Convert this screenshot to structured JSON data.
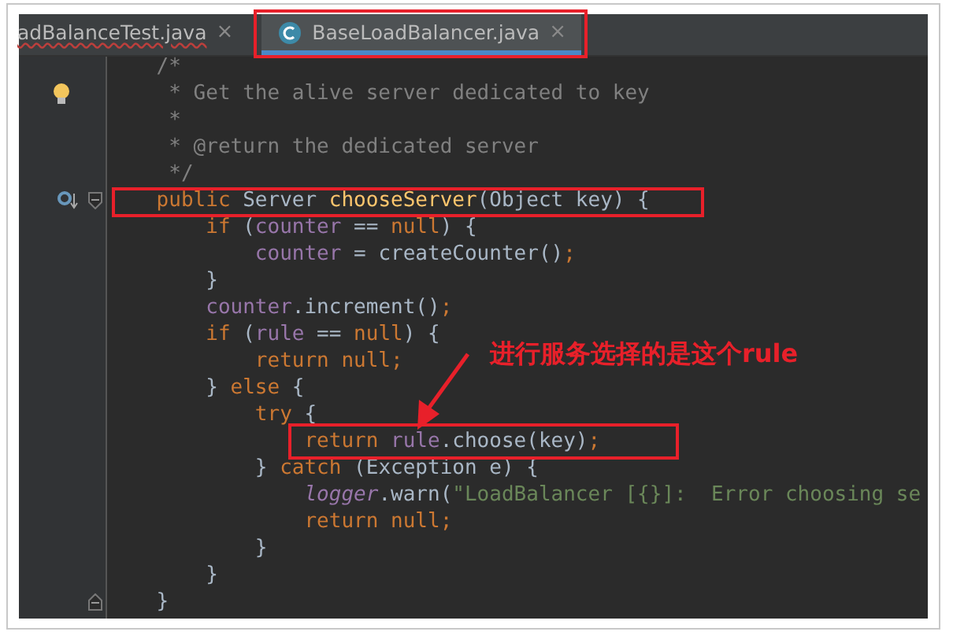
{
  "tabs": [
    {
      "label": "adBalanceTest.java",
      "selected": false,
      "error": true,
      "boxed": false
    },
    {
      "label": "BaseLoadBalancer.java",
      "selected": true,
      "error": false,
      "boxed": true
    }
  ],
  "tab_close": "×",
  "code_lines": [
    {
      "segments": [
        {
          "text": "    /*",
          "kind": "comment"
        }
      ]
    },
    {
      "bulb": true,
      "segments": [
        {
          "text": "     * Get the alive server dedicated to key",
          "kind": "comment"
        }
      ]
    },
    {
      "segments": [
        {
          "text": "     *",
          "kind": "comment"
        }
      ]
    },
    {
      "segments": [
        {
          "text": "     * @return the dedicated server",
          "kind": "comment"
        }
      ]
    },
    {
      "segments": [
        {
          "text": "     */",
          "kind": "comment"
        }
      ]
    },
    {
      "override_marker": true,
      "fold_start": true,
      "boxed": true,
      "segments": [
        {
          "text": "    public ",
          "kind": "keyword"
        },
        {
          "text": "Server ",
          "kind": "plain"
        },
        {
          "text": "chooseServer",
          "kind": "method"
        },
        {
          "text": "(Object key) {",
          "kind": "plain"
        }
      ]
    },
    {
      "segments": [
        {
          "text": "        if ",
          "kind": "keyword"
        },
        {
          "text": "(",
          "kind": "plain"
        },
        {
          "text": "counter",
          "kind": "field"
        },
        {
          "text": " == ",
          "kind": "plain"
        },
        {
          "text": "null",
          "kind": "keyword"
        },
        {
          "text": ") {",
          "kind": "plain"
        }
      ]
    },
    {
      "segments": [
        {
          "text": "            counter",
          "kind": "field"
        },
        {
          "text": " = createCounter()",
          "kind": "plain"
        },
        {
          "text": ";",
          "kind": "keyword"
        }
      ]
    },
    {
      "segments": [
        {
          "text": "        }",
          "kind": "plain"
        }
      ]
    },
    {
      "segments": [
        {
          "text": "        counter",
          "kind": "field"
        },
        {
          "text": ".increment()",
          "kind": "plain"
        },
        {
          "text": ";",
          "kind": "keyword"
        }
      ]
    },
    {
      "segments": [
        {
          "text": "        if ",
          "kind": "keyword"
        },
        {
          "text": "(",
          "kind": "plain"
        },
        {
          "text": "rule",
          "kind": "field"
        },
        {
          "text": " == ",
          "kind": "plain"
        },
        {
          "text": "null",
          "kind": "keyword"
        },
        {
          "text": ") {",
          "kind": "plain"
        }
      ]
    },
    {
      "segments": [
        {
          "text": "            return null;",
          "kind": "keyword"
        }
      ]
    },
    {
      "segments": [
        {
          "text": "        } ",
          "kind": "plain"
        },
        {
          "text": "else ",
          "kind": "keyword"
        },
        {
          "text": "{",
          "kind": "plain"
        }
      ]
    },
    {
      "segments": [
        {
          "text": "            try ",
          "kind": "keyword"
        },
        {
          "text": "{",
          "kind": "plain"
        }
      ]
    },
    {
      "boxed": true,
      "segments": [
        {
          "text": "                return ",
          "kind": "keyword"
        },
        {
          "text": "rule",
          "kind": "field"
        },
        {
          "text": ".choose(key)",
          "kind": "plain"
        },
        {
          "text": ";",
          "kind": "keyword"
        }
      ]
    },
    {
      "segments": [
        {
          "text": "            } ",
          "kind": "plain"
        },
        {
          "text": "catch ",
          "kind": "keyword"
        },
        {
          "text": "(Exception e) {",
          "kind": "plain"
        }
      ]
    },
    {
      "segments": [
        {
          "text": "                logger",
          "kind": "static"
        },
        {
          "text": ".warn(",
          "kind": "plain"
        },
        {
          "text": "\"LoadBalancer [{}]:  Error choosing se",
          "kind": "string"
        }
      ]
    },
    {
      "segments": [
        {
          "text": "                return null;",
          "kind": "keyword"
        }
      ]
    },
    {
      "segments": [
        {
          "text": "            }",
          "kind": "plain"
        }
      ]
    },
    {
      "segments": [
        {
          "text": "        }",
          "kind": "plain"
        }
      ]
    },
    {
      "fold_end": true,
      "segments": [
        {
          "text": "    }",
          "kind": "plain"
        }
      ]
    }
  ],
  "annotation": {
    "text": "进行服务选择的是这个rule"
  }
}
